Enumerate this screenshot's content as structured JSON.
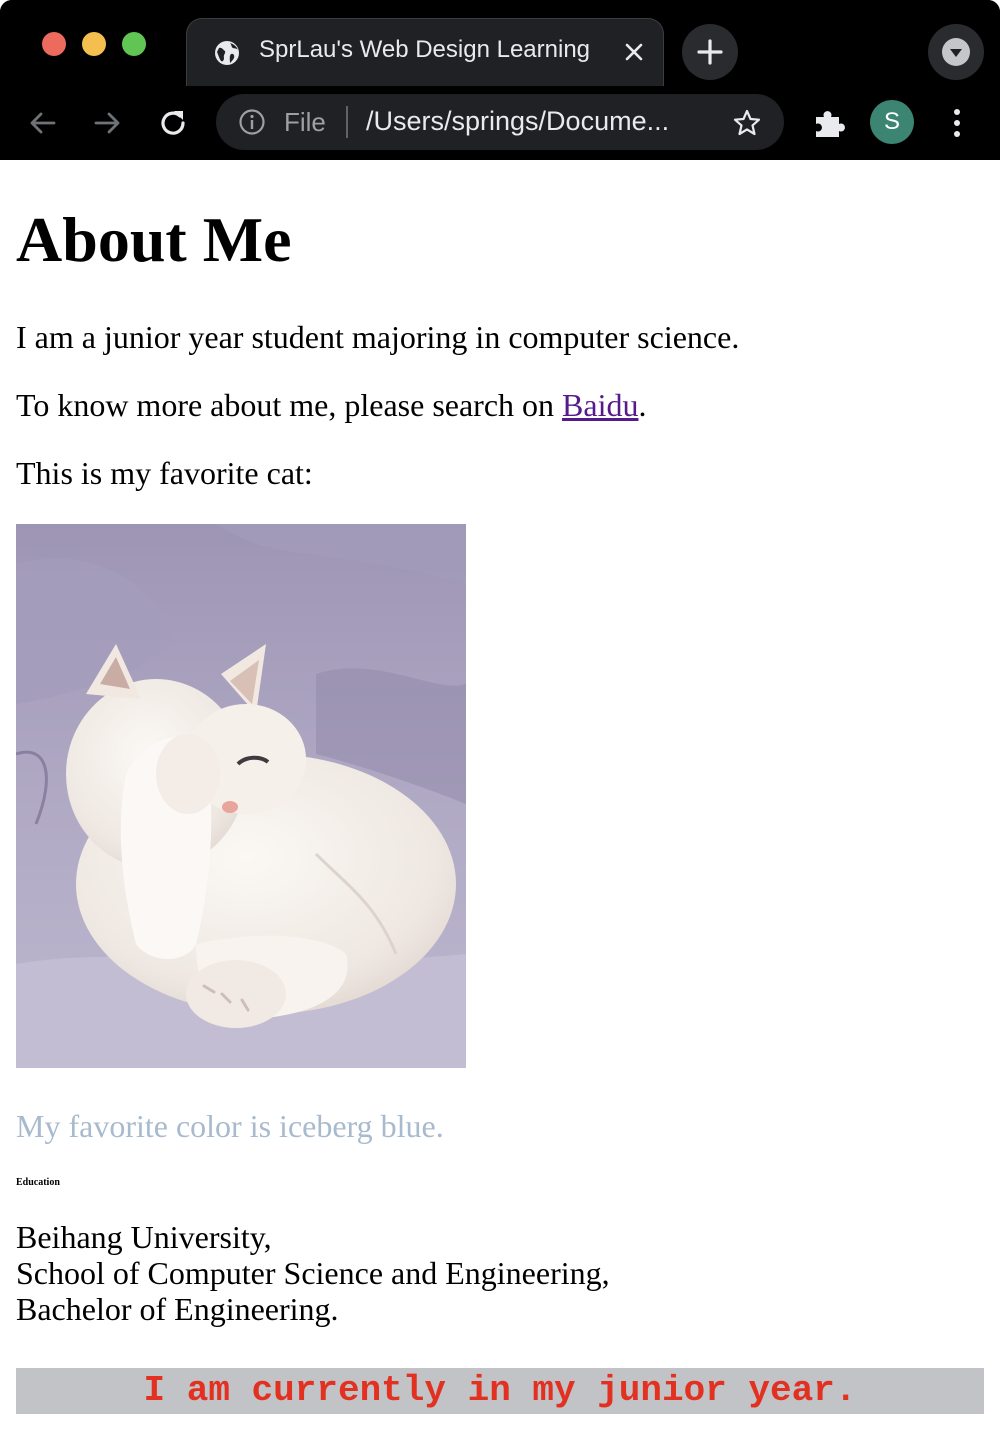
{
  "browser": {
    "tab": {
      "title": "SprLau's Web Design Learning"
    },
    "omnibox": {
      "scheme_label": "File",
      "url": "/Users/springs/Docume..."
    },
    "profile": {
      "initial": "S",
      "color": "#3b8572"
    },
    "icons": {
      "back": "back-arrow-icon",
      "forward": "forward-arrow-icon",
      "reload": "reload-icon",
      "info": "info-icon",
      "star": "star-icon",
      "extensions": "puzzle-icon",
      "menu": "kebab-menu-icon",
      "new_tab": "plus-icon",
      "tab_search": "chevron-down-icon",
      "globe": "globe-icon",
      "close": "close-icon"
    }
  },
  "page": {
    "heading": "About Me",
    "intro": "I am a junior year student majoring in computer science.",
    "search_prefix": "To know more about me, please search on ",
    "search_link": "Baidu",
    "search_suffix": ".",
    "cat_caption": "This is my favorite cat:",
    "favorite_color": "My favorite color is iceberg blue.",
    "favorite_color_hex": "#a8bacd",
    "education_heading": "Education",
    "education_lines": [
      "Beihang University,",
      "School of Computer Science and Engineering,",
      "Bachelor of Engineering."
    ],
    "junior_banner": "I am currently in my junior year.",
    "link_color": "#551a8b",
    "banner_text_color": "#e23121",
    "banner_bg_color": "#c2c3c7"
  }
}
